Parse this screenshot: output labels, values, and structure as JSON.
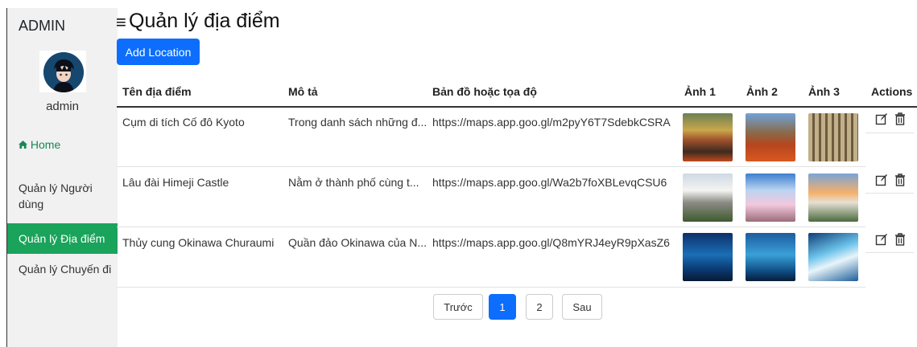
{
  "sidebar": {
    "brand": "ADMIN",
    "username": "admin",
    "items": [
      {
        "label": "Home",
        "icon": "home-icon"
      },
      {
        "label": "Quản lý Người dùng"
      },
      {
        "label": "Quản lý Địa điểm",
        "active": true
      },
      {
        "label": "Quản lý Chuyến đi"
      }
    ]
  },
  "header": {
    "menu_icon": "hamburger-icon",
    "title": "Quản lý địa điểm",
    "add_button": "Add Location"
  },
  "table": {
    "columns": [
      "Tên địa điểm",
      "Mô tả",
      "Bản đồ hoặc tọa độ",
      "Ảnh 1",
      "Ảnh 2",
      "Ảnh 3",
      "Actions"
    ],
    "rows": [
      {
        "name": "Cụm di tích Cố đô Kyoto",
        "desc": "Trong danh sách những đ...",
        "map": "https://maps.app.goo.gl/m2pyY6T7SdebkCSRA"
      },
      {
        "name": "Lâu đài Himeji Castle",
        "desc": "Nằm ở thành phố cùng t...",
        "map": "https://maps.app.goo.gl/Wa2b7foXBLevqCSU6"
      },
      {
        "name": "Thủy cung Okinawa Churaumi",
        "desc": "Quần đảo Okinawa của N...",
        "map": "https://maps.app.goo.gl/Q8mYRJ4eyR9pXasZ6"
      }
    ],
    "action_icons": [
      "edit-icon",
      "trash-icon"
    ]
  },
  "pagination": {
    "prev": "Trước",
    "pages": [
      "1",
      "2"
    ],
    "active_page": "1",
    "next": "Sau"
  },
  "colors": {
    "primary": "#0d6efd",
    "sidebar_active": "#1aa35a",
    "home_link": "#198754"
  }
}
